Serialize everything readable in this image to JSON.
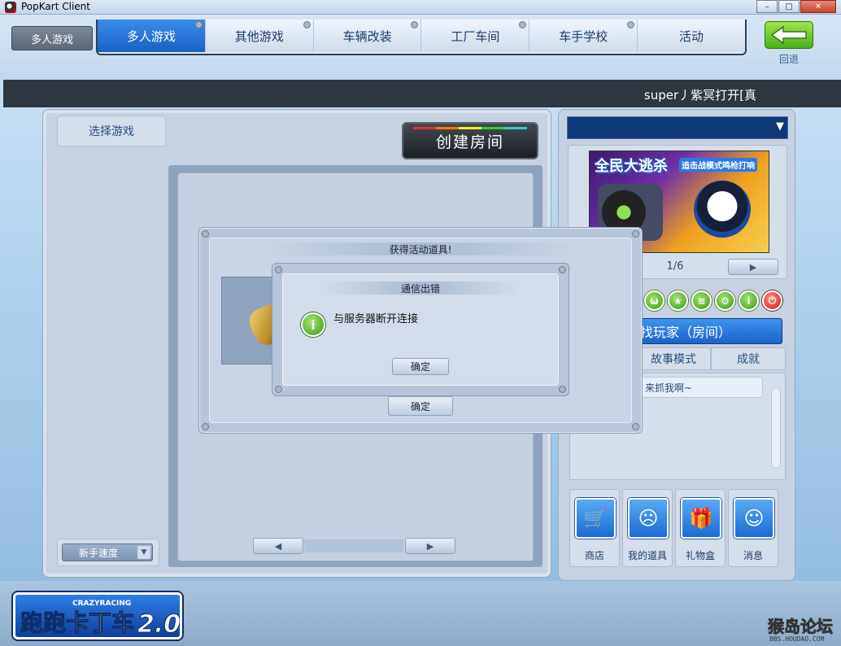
{
  "window": {
    "title": "PopKart Client",
    "controls": [
      "–",
      "□",
      "✕"
    ]
  },
  "nav": {
    "section_label": "多人游戏",
    "tabs": [
      "多人游戏",
      "其他游戏",
      "车辆改装",
      "工厂车间",
      "车手学校",
      "活动"
    ],
    "active_tab": 0,
    "back_label": "回退"
  },
  "user": {
    "name": "super丿紫冥打开[真"
  },
  "left": {
    "select_tab": "选择游戏",
    "create_room": "创建房间",
    "pager_prev": "◀",
    "pager_next": "▶",
    "speed_value": "新手速度",
    "speed_arrow": "▼"
  },
  "right": {
    "dropdown_arrow": "▼",
    "banner_title": "全民大逃杀",
    "banner_subtitle": "追击战模式鸣枪打响",
    "banner_page": "1/6",
    "banner_next": "▶",
    "icon_row": [
      "ω",
      "★",
      "≡",
      "⚙",
      "i",
      "⏻"
    ],
    "find_player": "找玩家（房间）",
    "mode_tabs": [
      "故事模式",
      "成就"
    ],
    "chat_message": "来抓我啊~",
    "quick_buttons": [
      {
        "label": "商店",
        "icon": "🛒"
      },
      {
        "label": "我的道具",
        "icon": "☹"
      },
      {
        "label": "礼物盒",
        "icon": "🎁"
      },
      {
        "label": "消息",
        "icon": "☺"
      }
    ]
  },
  "dialog_reward": {
    "title": "获得活动道具!",
    "ok": "确定"
  },
  "dialog_error": {
    "title": "通信出错",
    "message": "与服务器断开连接",
    "icon": "i",
    "ok": "确定"
  },
  "logo": {
    "top": "CRAZYRACING",
    "main": "跑跑卡丁车",
    "version": "2.0"
  },
  "watermark": {
    "main": "猴岛论坛",
    "sub": "BBS.HOUDAO.COM"
  }
}
